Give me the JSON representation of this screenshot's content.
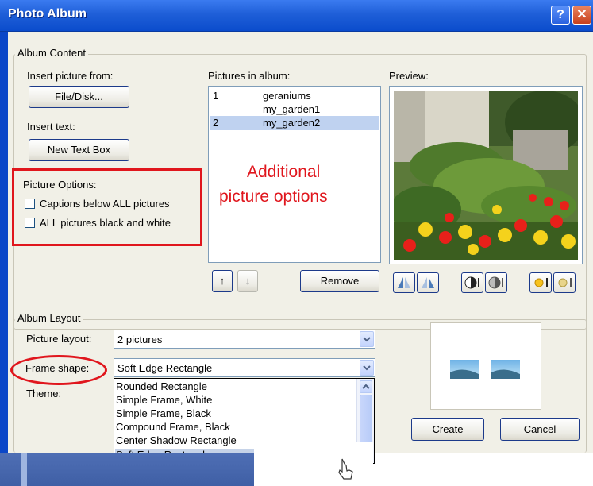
{
  "window": {
    "title": "Photo Album",
    "help_icon": "?",
    "close_icon": "✕"
  },
  "album_content": {
    "legend": "Album Content",
    "insert_picture_label": "Insert picture from:",
    "file_disk_button": "File/Disk...",
    "insert_text_label": "Insert text:",
    "new_text_box_button": "New Text Box",
    "picture_options_label": "Picture Options:",
    "captions_checkbox": "Captions below ALL pictures",
    "bw_checkbox": "ALL pictures black and white",
    "pictures_in_album_label": "Pictures in album:",
    "pictures": [
      {
        "num": "1",
        "name": "geraniums"
      },
      {
        "num": "",
        "name": "my_garden1"
      },
      {
        "num": "2",
        "name": "my_garden2"
      }
    ],
    "annotation": [
      "Additional",
      "picture options"
    ],
    "remove_button": "Remove",
    "preview_label": "Preview:"
  },
  "album_layout": {
    "legend": "Album Layout",
    "picture_layout_label": "Picture layout:",
    "picture_layout_value": "2 pictures",
    "frame_shape_label": "Frame shape:",
    "frame_shape_value": "Soft Edge Rectangle",
    "theme_label": "Theme:",
    "frame_options": [
      "Rounded Rectangle",
      "Simple Frame, White",
      "Simple Frame, Black",
      "Compound Frame, Black",
      "Center Shadow Rectangle",
      "Soft Edge Rectangle"
    ]
  },
  "buttons": {
    "create": "Create",
    "cancel": "Cancel"
  },
  "colors": {
    "annotation_red": "#e0161d",
    "title_blue": "#1f5fd8",
    "selection": "#bfd2f0"
  }
}
